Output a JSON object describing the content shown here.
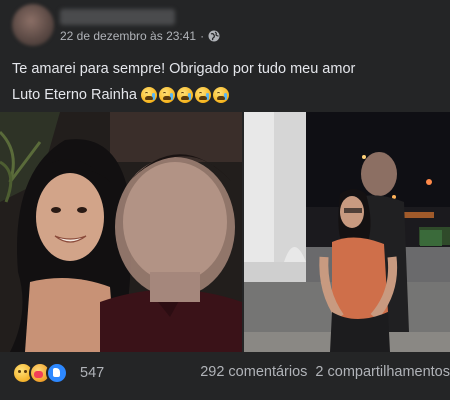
{
  "post": {
    "timestamp": "22 de dezembro às 23:41",
    "separator": "·",
    "privacy_icon": "globe-icon",
    "caption_line1": "Te amarei para sempre! Obrigado por tudo meu amor",
    "caption_line2": "Luto Eterno Rainha",
    "caption_emoji": "loudly-crying-face",
    "caption_emoji_count": 5
  },
  "photos": [
    {
      "name": "couple-photo-left",
      "faces_blurred": 1
    },
    {
      "name": "couple-photo-right",
      "faces_blurred": 1
    }
  ],
  "reactions": {
    "types": [
      "sad",
      "care",
      "like"
    ],
    "count": "547"
  },
  "stats": {
    "comments": "292 comentários",
    "shares": "2 compartilhamentos"
  },
  "colors": {
    "background": "#242526",
    "text_primary": "#e4e6eb",
    "text_secondary": "#b0b3b8",
    "like_blue": "#2d88ff"
  }
}
